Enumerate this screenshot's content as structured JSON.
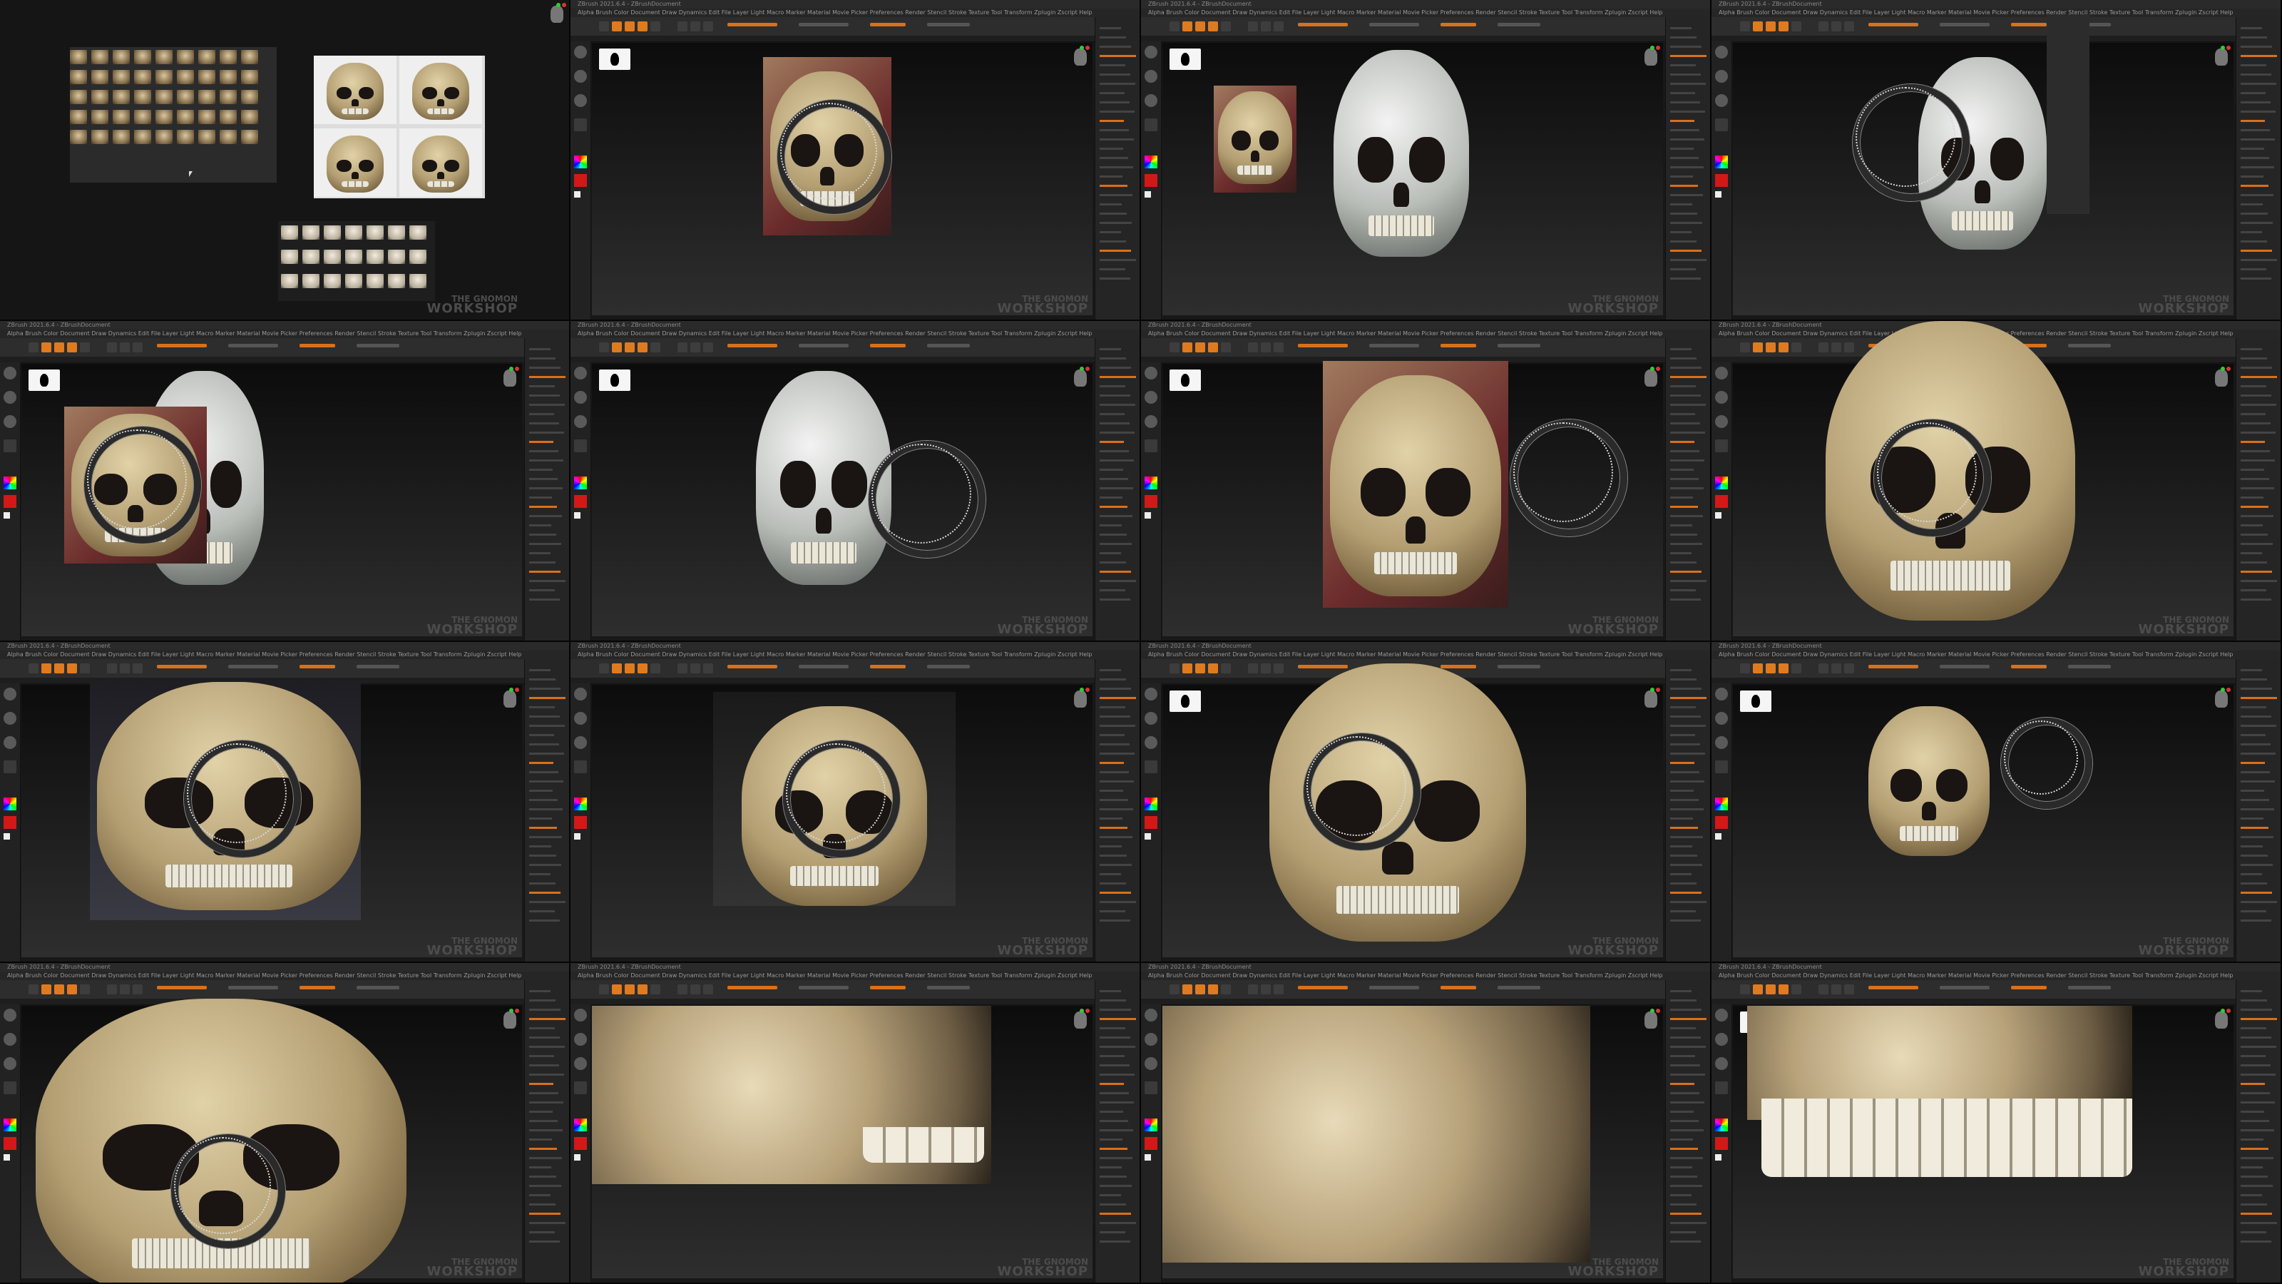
{
  "app": {
    "title": "ZBrush 2021.6.4 - ZBrushDocument",
    "menu": [
      "Alpha",
      "Brush",
      "Color",
      "Document",
      "Draw",
      "Dynamics",
      "Edit",
      "File",
      "Layer",
      "Light",
      "Macro",
      "Marker",
      "Material",
      "Movie",
      "Picker",
      "Preferences",
      "Render",
      "Stencil",
      "Stroke",
      "Texture",
      "Tool",
      "Transform",
      "Zplugin",
      "Zscript",
      "Help"
    ]
  },
  "watermark": {
    "line1": "THE GNOMON",
    "line2": "WORKSHOP"
  },
  "colors": {
    "accent": "#e07a1f",
    "background": "#181818",
    "viewport_top": "#0c0c0c",
    "viewport_bottom": "#2e2e2e"
  },
  "icons": [
    "mask-icon",
    "navigation-cube-icon",
    "brush-icon",
    "material-icon",
    "color-picker-icon"
  ]
}
